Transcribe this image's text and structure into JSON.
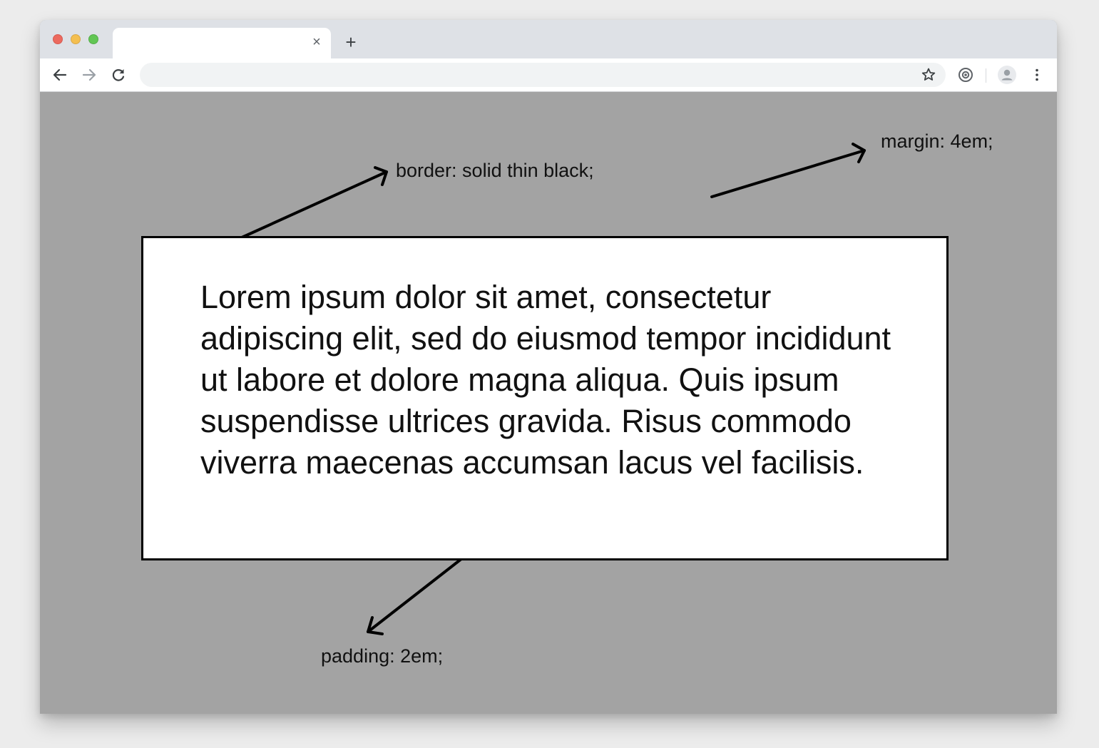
{
  "browser": {
    "tab": {
      "title": "",
      "close_glyph": "×",
      "close_icon": "close-icon"
    },
    "new_tab_glyph": "+",
    "new_tab_icon": "plus-icon",
    "address_bar": {
      "url": ""
    },
    "toolbar_icons": [
      "back-arrow-icon",
      "forward-arrow-icon",
      "reload-icon",
      "star-icon",
      "extension-icon",
      "avatar-icon",
      "more-vert-icon"
    ],
    "traffic_light_colors": {
      "close": "#ec6a5f",
      "minimize": "#f4bf50",
      "maximize": "#62c654"
    }
  },
  "page": {
    "background_color": "#a3a3a3",
    "box": {
      "text": "Lorem ipsum dolor sit amet, consectetur adipiscing elit, sed do eiusmod tempor incididunt ut labore et dolore magna aliqua. Quis ipsum suspendisse ultrices gravida. Risus commodo viverra maecenas accumsan lacus vel facilisis.",
      "background_color": "#ffffff",
      "border_color": "#000000"
    },
    "annotations": {
      "border": "border: solid thin black;",
      "margin": "margin: 4em;",
      "padding": "padding: 2em;"
    }
  }
}
